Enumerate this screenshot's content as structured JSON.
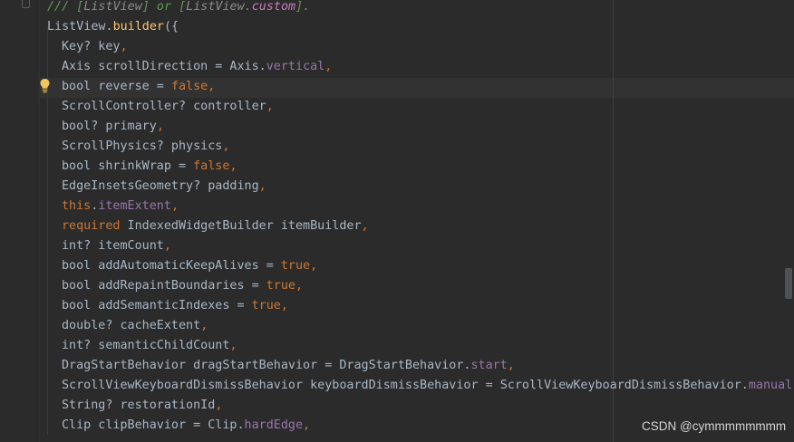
{
  "doc_comment": {
    "prefix": "/// ",
    "open1": "[",
    "ref1": "ListView",
    "close1": "]",
    "or": " or ",
    "open2": "[",
    "ref2a": "ListView",
    "dot": ".",
    "ref2b": "custom",
    "close2": "].",
    "full": "/// [ListView] or [ListView.custom]."
  },
  "header": {
    "class": "ListView",
    "dot": ".",
    "method": "builder",
    "open": "({"
  },
  "params": [
    {
      "type": "Key? key",
      "comma": ","
    },
    {
      "type": "Axis scrollDirection = Axis.",
      "field": "vertical",
      "comma": ","
    },
    {
      "type": "bool reverse = ",
      "kw": "false",
      "comma": ","
    },
    {
      "type": "ScrollController? controller",
      "comma": ","
    },
    {
      "type": "bool? primary",
      "comma": ","
    },
    {
      "type": "ScrollPhysics? physics",
      "comma": ","
    },
    {
      "type": "bool shrinkWrap = ",
      "kw": "false",
      "comma": ","
    },
    {
      "type": "EdgeInsetsGeometry? padding",
      "comma": ","
    },
    {
      "kw_pre": "this",
      "dot": ".",
      "field": "itemExtent",
      "comma": ","
    },
    {
      "kw_pre": "required",
      "type": " IndexedWidgetBuilder itemBuilder",
      "comma": ","
    },
    {
      "type": "int? itemCount",
      "comma": ","
    },
    {
      "type": "bool addAutomaticKeepAlives = ",
      "kw": "true",
      "comma": ","
    },
    {
      "type": "bool addRepaintBoundaries = ",
      "kw": "true",
      "comma": ","
    },
    {
      "type": "bool addSemanticIndexes = ",
      "kw": "true",
      "comma": ","
    },
    {
      "type": "double? cacheExtent",
      "comma": ","
    },
    {
      "type": "int? semanticChildCount",
      "comma": ","
    },
    {
      "type": "DragStartBehavior dragStartBehavior = DragStartBehavior.",
      "field": "start",
      "comma": ","
    },
    {
      "type": "ScrollViewKeyboardDismissBehavior keyboardDismissBehavior = ScrollViewKeyboardDismissBehavior.",
      "field": "manual",
      "comma": ","
    },
    {
      "type": "String? restorationId",
      "comma": ","
    },
    {
      "type": "Clip clipBehavior = Clip.",
      "field": "hardEdge",
      "comma": ","
    }
  ],
  "watermark": "CSDN @cymmmmmmmm",
  "colors": {
    "background": "#2b2b2b",
    "text": "#a9b7c6",
    "keyword": "#cc7832",
    "method": "#ffc66d",
    "field": "#9876aa",
    "doc": "#629755",
    "bulb": "#f2c55c"
  },
  "icons": {
    "intention": "lightbulb-icon",
    "fold": "fold-marker-icon"
  }
}
